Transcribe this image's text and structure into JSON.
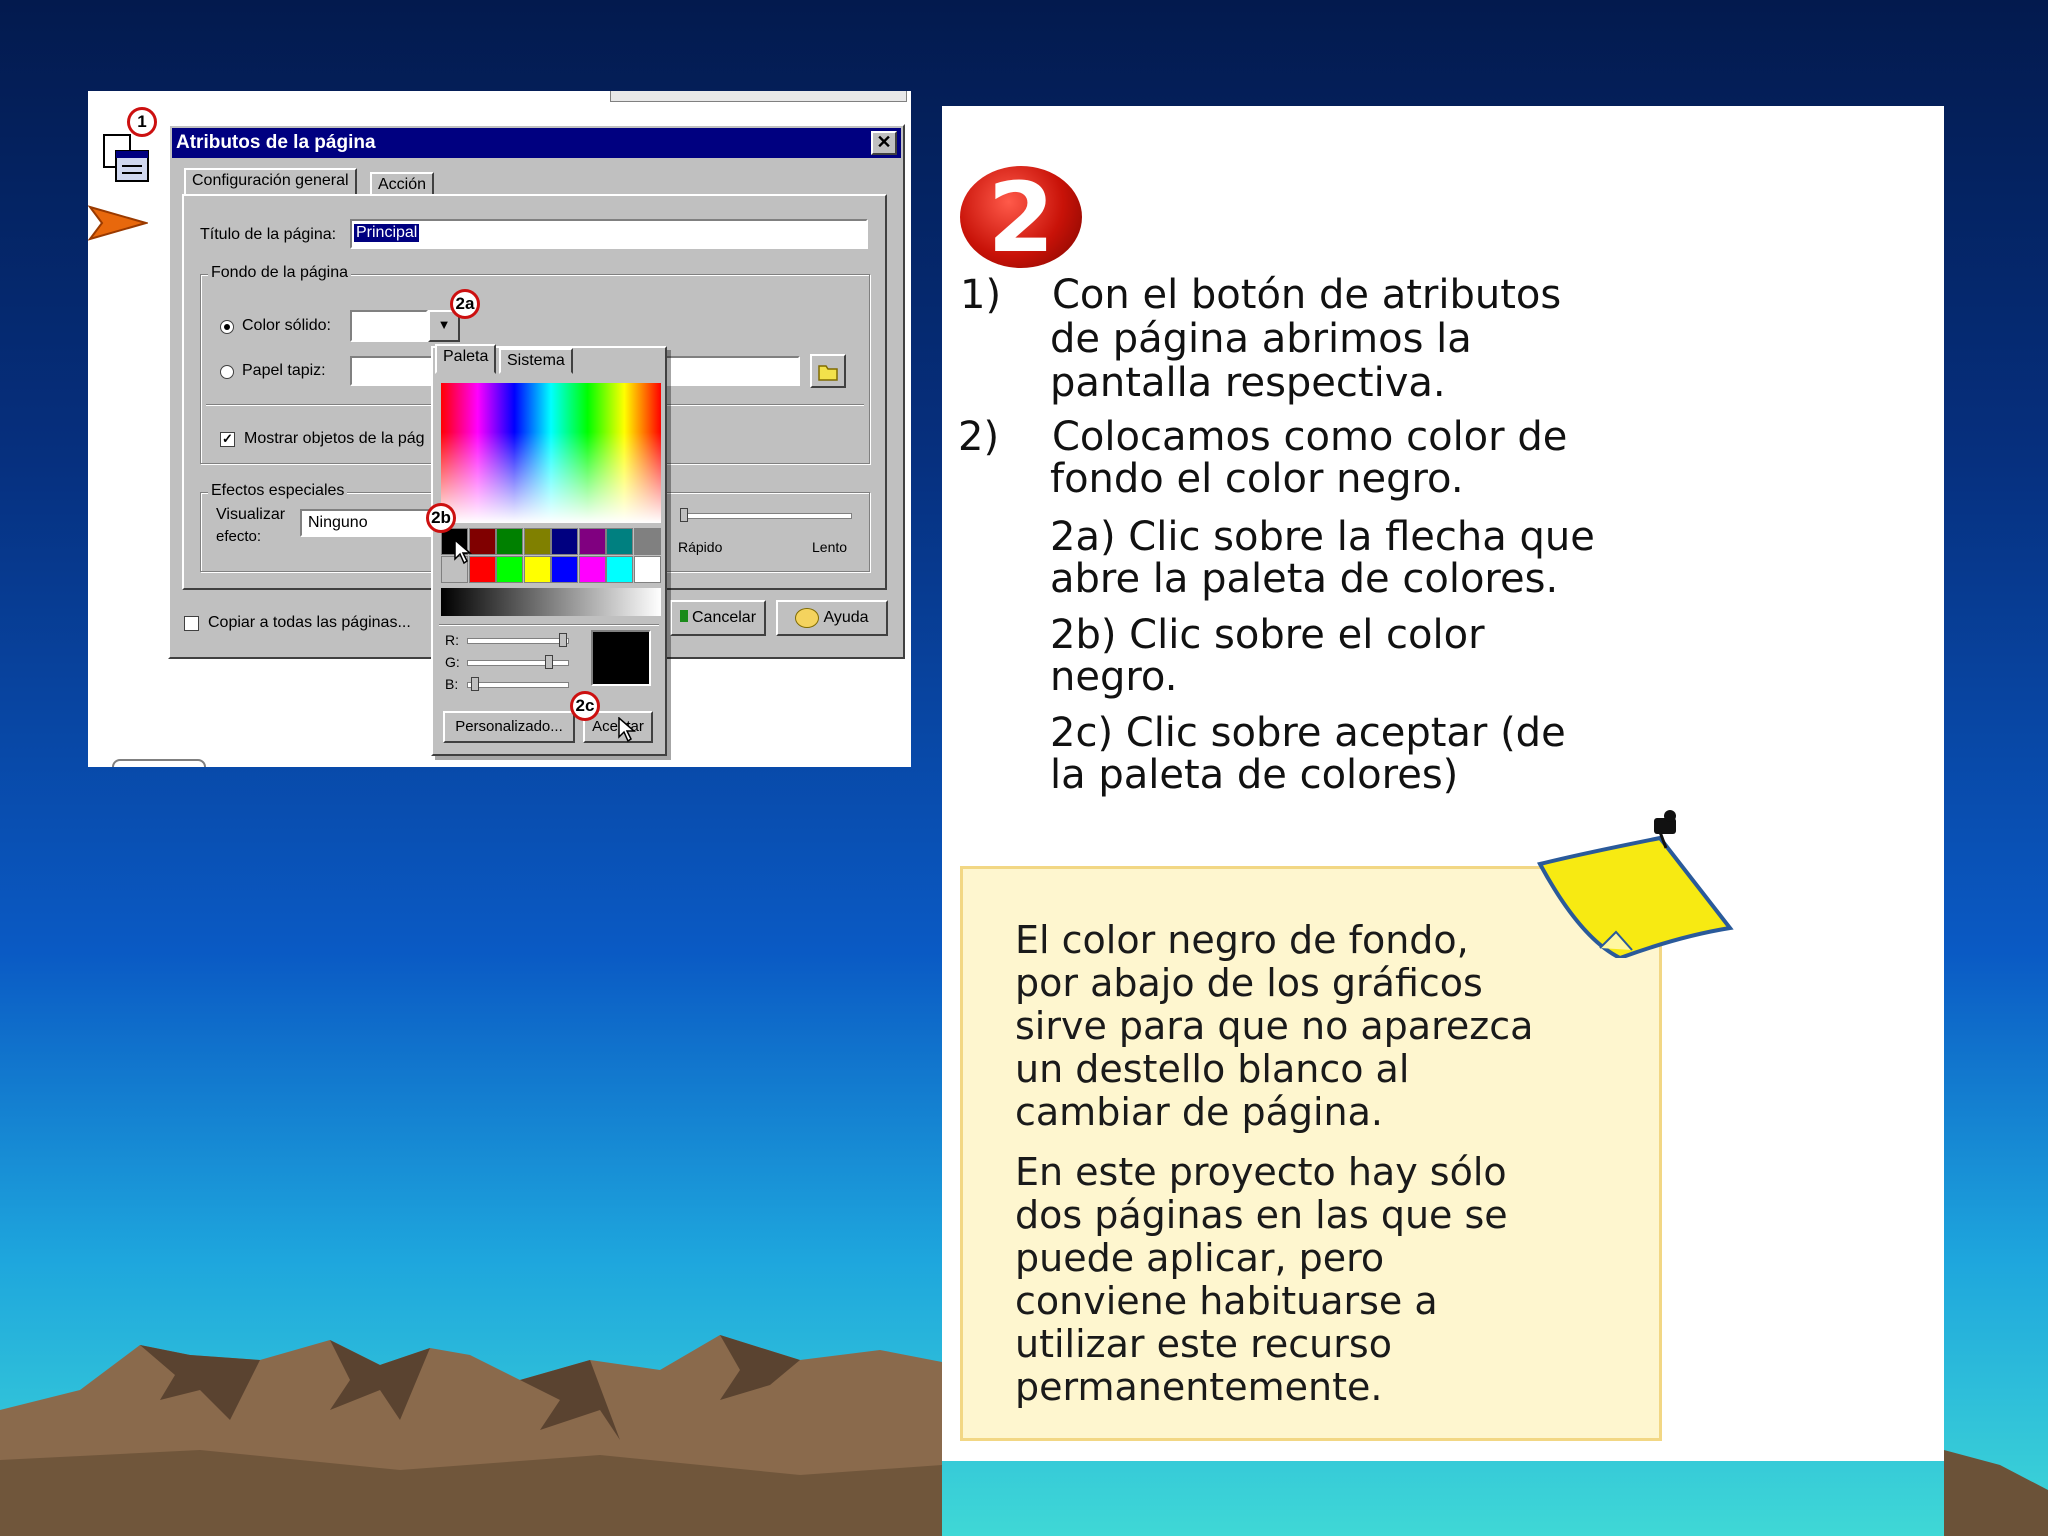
{
  "colors": {
    "accent_red": "#cc1010",
    "title_bar": "#000080",
    "note_bg": "#fef6cf"
  },
  "dialog": {
    "title": "Atributos de la página",
    "close_glyph": "✕",
    "tabs": [
      "Configuración general",
      "Acción"
    ],
    "page_title_label": "Título de la página:",
    "page_title_value": "Principal",
    "background_group": "Fondo de la página",
    "solid_color_label": "Color sólido:",
    "wallpaper_label": "Papel tapiz:",
    "show_objects_label": "Mostrar objetos de la pág",
    "effects_group": "Efectos especiales",
    "visualize_label_1": "Visualizar",
    "visualize_label_2": "efecto:",
    "effect_value": "Ninguno",
    "speed_fast": "Rápido",
    "speed_slow": "Lento",
    "copy_all_label": "Copiar a todas las páginas...",
    "cancel_label": "Cancelar",
    "help_label": "Ayuda"
  },
  "palette": {
    "tabs": [
      "Paleta",
      "Sistema"
    ],
    "r_label": "R:",
    "g_label": "G:",
    "b_label": "B:",
    "custom_button": "Personalizado...",
    "accept_button": "Aceptar",
    "basic_colors_row1": [
      "#000000",
      "#800000",
      "#008000",
      "#808000",
      "#000080",
      "#800080",
      "#008080",
      "#808080"
    ],
    "basic_colors_row2": [
      "#c0c0c0",
      "#ff0000",
      "#00ff00",
      "#ffff00",
      "#0000ff",
      "#ff00ff",
      "#00ffff",
      "#ffffff"
    ],
    "preview_color": "#000000"
  },
  "badges": {
    "b1": "1",
    "b2a": "2a",
    "b2b": "2b",
    "b2c": "2c"
  },
  "instructions": {
    "big_number": "2",
    "s1_num": "1)",
    "s1_l1": "Con el botón de atributos",
    "s1_l2": "de página abrimos la",
    "s1_l3": "pantalla respectiva.",
    "s2_num": "2)",
    "s2_l1": "Colocamos como color de",
    "s2_l2": "fondo el color negro.",
    "s2a_l1": "2a) Clic sobre la flecha que",
    "s2a_l2": "abre la paleta de colores.",
    "s2b_l1": "2b) Clic sobre el color",
    "s2b_l2": "negro.",
    "s2c_l1": "2c) Clic sobre aceptar (de",
    "s2c_l2": "la paleta de colores)"
  },
  "note": {
    "p1": [
      "El color negro de fondo,",
      "por abajo de los gráficos",
      "sirve para que no aparezca",
      "un destello blanco al",
      "cambiar de página."
    ],
    "p2": [
      "En este proyecto hay sólo",
      "dos páginas en las que se",
      "puede aplicar, pero",
      "conviene habituarse a",
      "utilizar este recurso",
      "permanentemente."
    ]
  }
}
